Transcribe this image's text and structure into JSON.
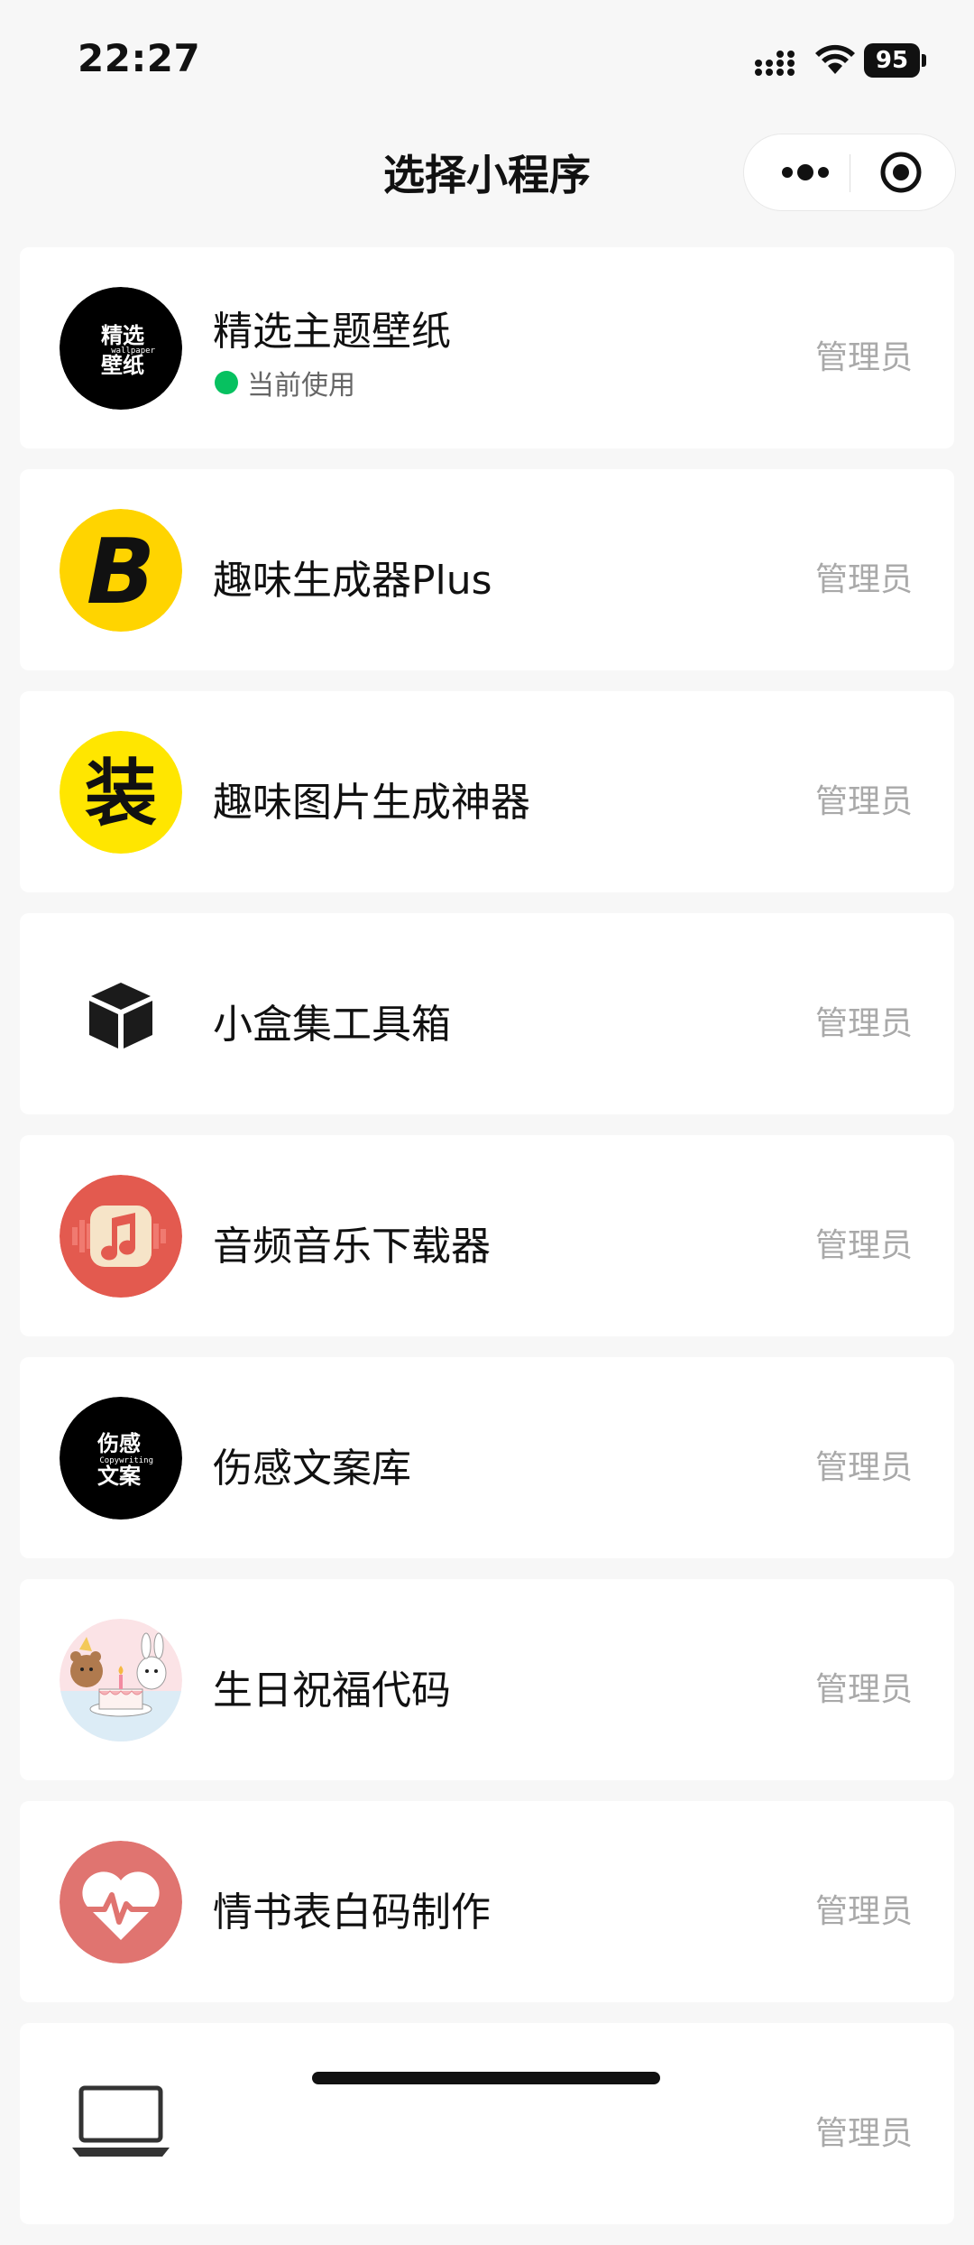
{
  "status_bar": {
    "time": "22:27",
    "battery": "95",
    "icons": [
      "signal-icon",
      "wifi-icon",
      "battery-icon"
    ]
  },
  "header": {
    "title": "选择小程序",
    "capsule_icons": [
      "more-icon",
      "close-icon"
    ]
  },
  "apps": [
    {
      "name": "精选主题壁纸",
      "status": "当前使用",
      "role": "管理员",
      "icon": "wallpaper-logo-icon",
      "icon_text_main": [
        "精选",
        "壁纸"
      ],
      "icon_text_small": "wallpaper",
      "icon_bg": "#000000"
    },
    {
      "name": "趣味生成器Plus",
      "role": "管理员",
      "icon": "letter-b-logo-icon",
      "icon_text": "B",
      "icon_bg": "#ffd400"
    },
    {
      "name": "趣味图片生成神器",
      "role": "管理员",
      "icon": "zhuang-logo-icon",
      "icon_text": "装",
      "icon_bg": "#ffe600"
    },
    {
      "name": "小盒集工具箱",
      "role": "管理员",
      "icon": "box-icon"
    },
    {
      "name": "音频音乐下载器",
      "role": "管理员",
      "icon": "music-note-icon",
      "icon_bg": "#e35a4f"
    },
    {
      "name": "伤感文案库",
      "role": "管理员",
      "icon": "copywriting-logo-icon",
      "icon_text_main": [
        "伤感",
        "文案"
      ],
      "icon_text_small": "Copywriting",
      "icon_bg": "#000000"
    },
    {
      "name": "生日祝福代码",
      "role": "管理员",
      "icon": "birthday-cake-icon"
    },
    {
      "name": "情书表白码制作",
      "role": "管理员",
      "icon": "heart-pulse-icon",
      "icon_bg": "#e07470"
    },
    {
      "role": "管理员",
      "icon": "laptop-icon"
    }
  ]
}
